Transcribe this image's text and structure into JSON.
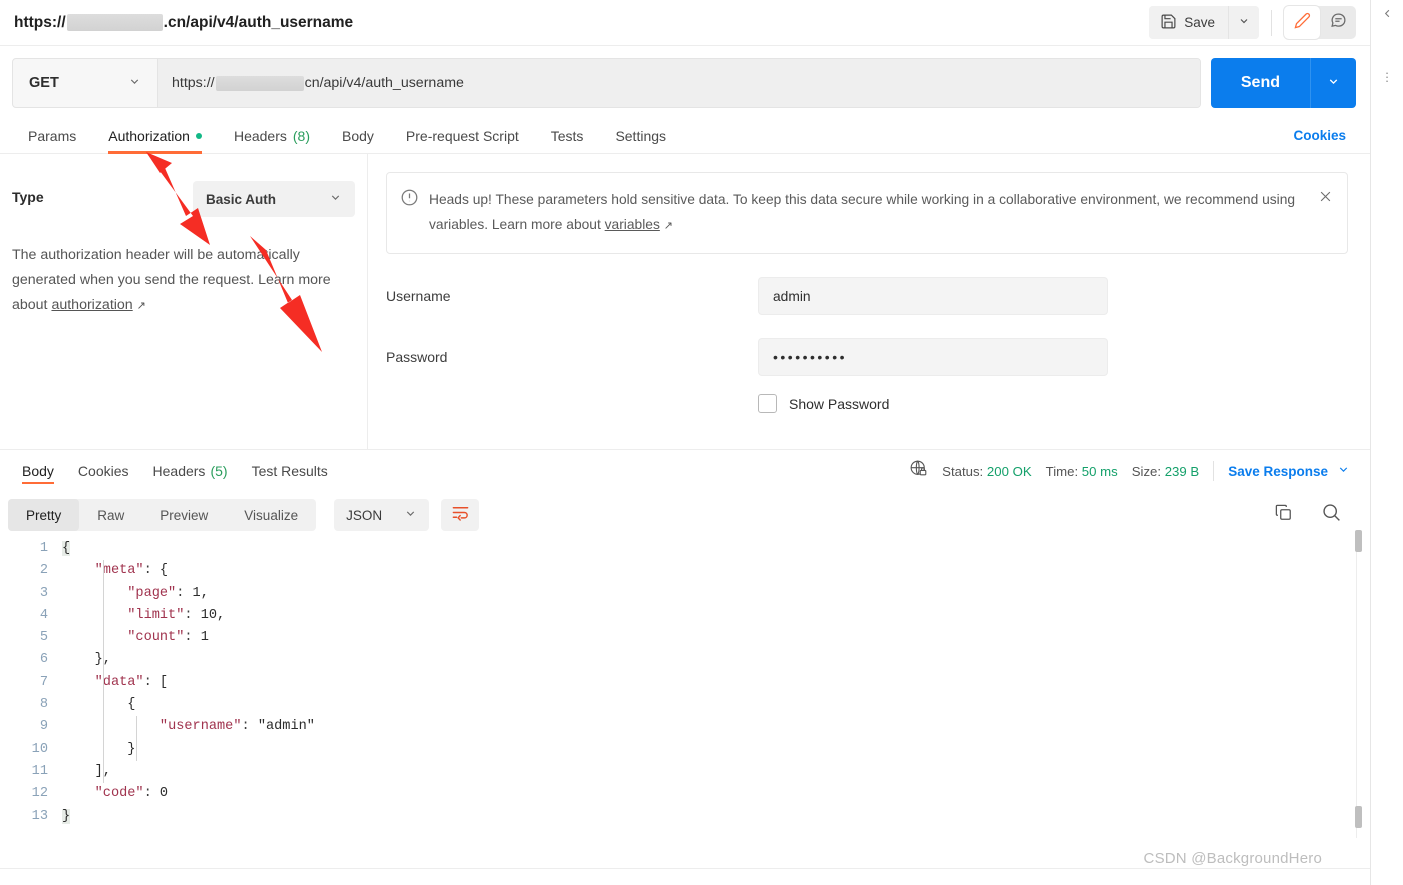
{
  "header": {
    "request_title_prefix": "https://",
    "request_title_suffix": ".cn/api/v4/auth_username",
    "save_label": "Save",
    "save_caret_icon": "chevron-down-icon",
    "edit_icon": "pencil-icon",
    "comment_icon": "comment-icon"
  },
  "url_bar": {
    "method": "GET",
    "method_caret_icon": "chevron-down-icon",
    "url_prefix": "https://",
    "url_suffix": "cn/api/v4/auth_username",
    "send_label": "Send",
    "send_caret_icon": "chevron-down-icon"
  },
  "request_tabs": {
    "items": [
      {
        "label": "Params",
        "active": false
      },
      {
        "label": "Authorization",
        "active": true,
        "dot": true
      },
      {
        "label": "Headers",
        "count": "(8)",
        "active": false
      },
      {
        "label": "Body",
        "active": false
      },
      {
        "label": "Pre-request Script",
        "active": false
      },
      {
        "label": "Tests",
        "active": false
      },
      {
        "label": "Settings",
        "active": false
      }
    ],
    "cookies_label": "Cookies"
  },
  "authorization": {
    "type_label": "Type",
    "type_value": "Basic Auth",
    "type_caret_icon": "chevron-down-icon",
    "description_part1": "The authorization header will be automatically generated when you send the request. Learn more about ",
    "description_link": "authorization",
    "external_icon": "↗"
  },
  "notice": {
    "warning_icon": "alert-circle-icon",
    "text_part1": "Heads up! These parameters hold sensitive data. To keep this data secure while working in a collaborative environment, we recommend using variables. Learn more about ",
    "link": "variables",
    "external_icon": "↗",
    "close_icon": "close-icon"
  },
  "credentials": {
    "username_label": "Username",
    "username_value": "admin",
    "password_label": "Password",
    "password_value": "••••••••••",
    "show_password_label": "Show Password",
    "show_password_checked": false
  },
  "response_tabs": {
    "items": [
      {
        "label": "Body",
        "active": true
      },
      {
        "label": "Cookies",
        "active": false
      },
      {
        "label": "Headers",
        "count": "(5)",
        "active": false
      },
      {
        "label": "Test Results",
        "active": false
      }
    ],
    "globe_icon": "globe-lock-icon",
    "status_label": "Status:",
    "status_value": "200 OK",
    "time_label": "Time:",
    "time_value": "50 ms",
    "size_label": "Size:",
    "size_value": "239 B",
    "save_response_label": "Save Response",
    "save_response_caret_icon": "chevron-down-icon"
  },
  "format_bar": {
    "modes": [
      {
        "label": "Pretty",
        "active": true
      },
      {
        "label": "Raw",
        "active": false
      },
      {
        "label": "Preview",
        "active": false
      },
      {
        "label": "Visualize",
        "active": false
      }
    ],
    "language": "JSON",
    "language_caret_icon": "chevron-down-icon",
    "wrap_icon": "word-wrap-icon",
    "copy_icon": "copy-icon",
    "search_icon": "search-icon"
  },
  "response_body": {
    "language": "json",
    "line_numbers": [
      "1",
      "2",
      "3",
      "4",
      "5",
      "6",
      "7",
      "8",
      "9",
      "10",
      "11",
      "12",
      "13"
    ],
    "raw": "{\n    \"meta\": {\n        \"page\": 1,\n        \"limit\": 10,\n        \"count\": 1\n    },\n    \"data\": [\n        {\n            \"username\": \"admin\"\n        }\n    ],\n    \"code\": 0\n}",
    "parsed": {
      "meta": {
        "page": 1,
        "limit": 10,
        "count": 1
      },
      "data": [
        {
          "username": "admin"
        }
      ],
      "code": 0
    }
  },
  "right_rail": {
    "chevron_icon": "chevron-left-icon",
    "more_icon": "more-vertical-icon"
  },
  "watermark": "CSDN @BackgroundHero",
  "colors": {
    "accent_orange": "#ff6c37",
    "primary_blue": "#0b7ded",
    "status_green": "#14a06a",
    "dot_green": "#12b886",
    "annotation_red": "#f52d24"
  }
}
